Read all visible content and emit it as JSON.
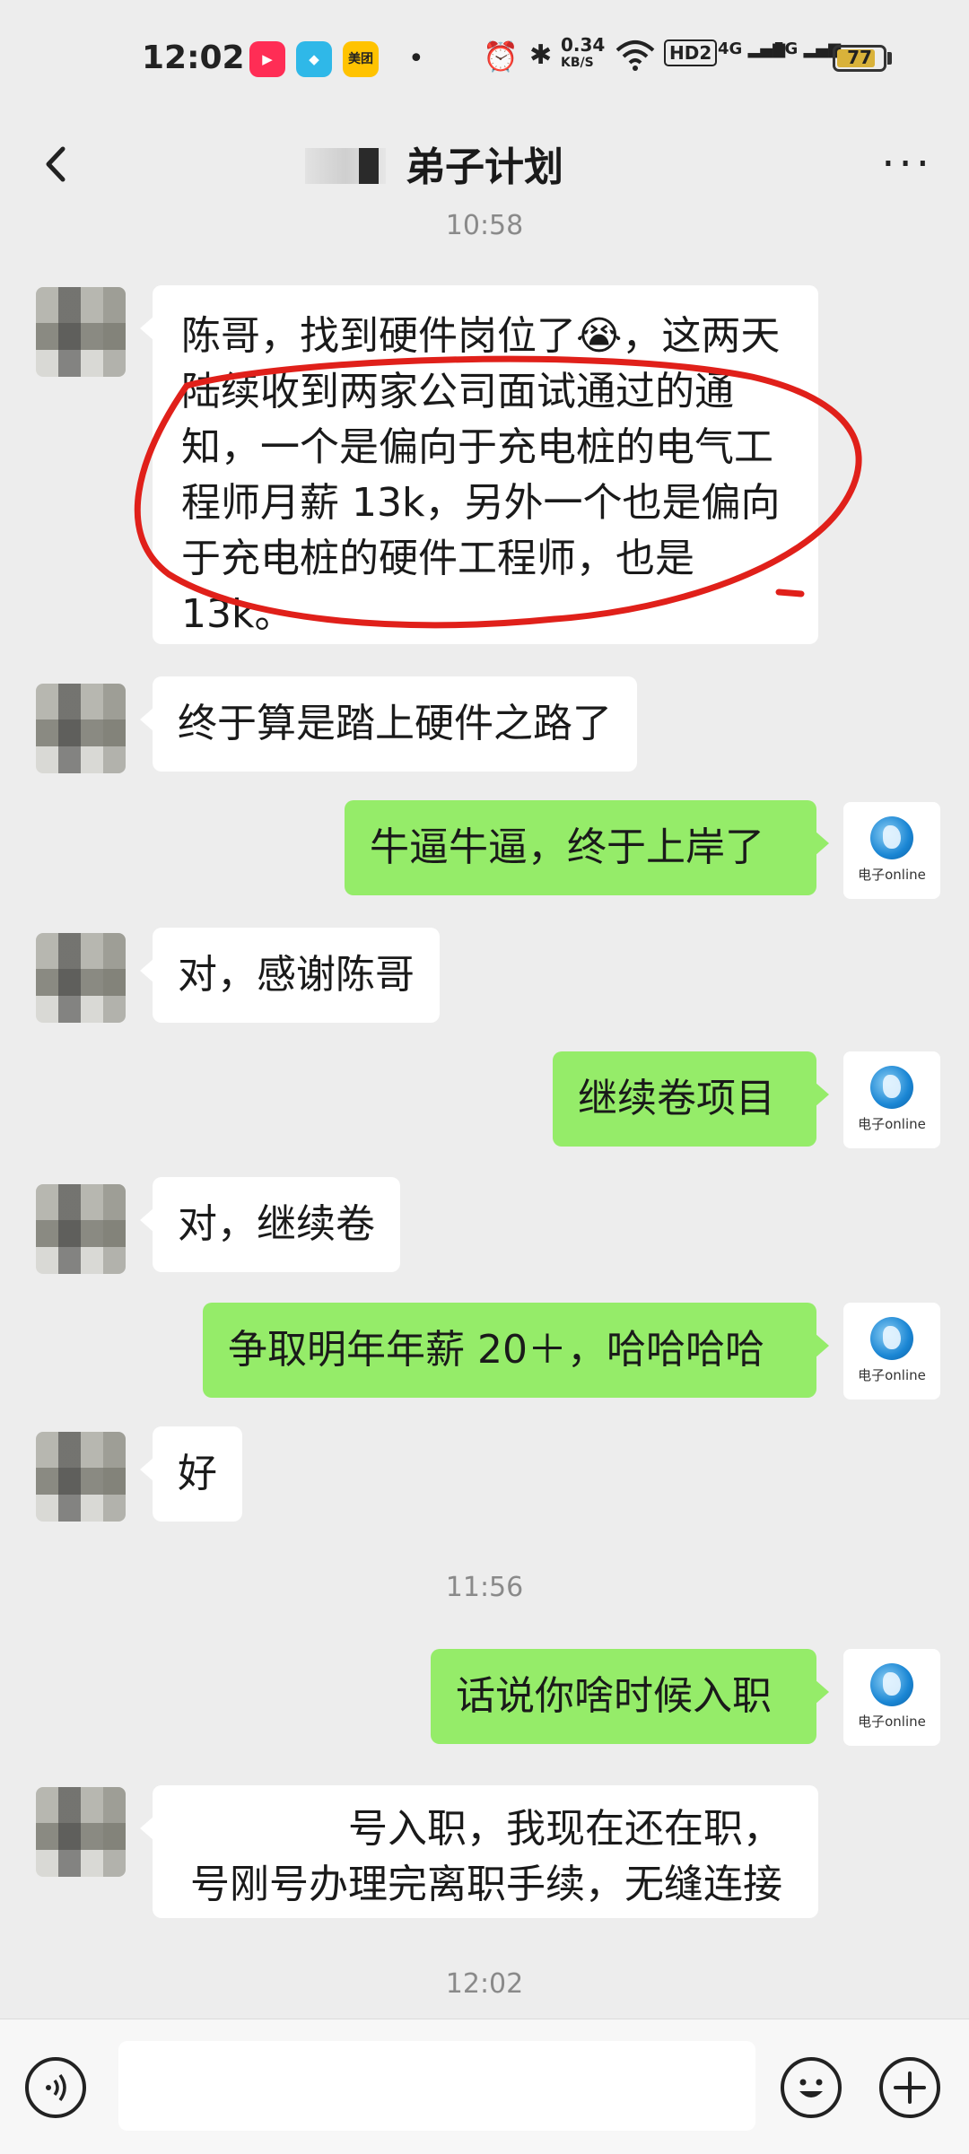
{
  "status_bar": {
    "time": "12:02",
    "app_badge_2": "美团",
    "net_speed": "0.34",
    "net_unit": "KB/S",
    "hd": "HD2",
    "signal_1": "4G",
    "signal_2": "5G",
    "battery": "77"
  },
  "nav": {
    "title": "弟子计划"
  },
  "timestamps": [
    "10:58",
    "11:56",
    "12:02"
  ],
  "messages": [
    {
      "side": "left",
      "lines": [
        "陈哥，找到硬件岗位了😭，这两天",
        "陆续收到两家公司面试通过的通",
        "知，一个是偏向于充电桩的电气工",
        "程师月薪 13k，另外一个也是偏向",
        "于充电桩的硬件工程师，也是",
        "13k。"
      ]
    },
    {
      "side": "left",
      "text": "终于算是踏上硬件之路了"
    },
    {
      "side": "right",
      "text": "牛逼牛逼，终于上岸了"
    },
    {
      "side": "left",
      "text": "对，感谢陈哥"
    },
    {
      "side": "right",
      "text": "继续卷项目"
    },
    {
      "side": "left",
      "text": "对，继续卷"
    },
    {
      "side": "right",
      "text": "争取明年年薪 20＋，哈哈哈哈"
    },
    {
      "side": "left",
      "text": "好"
    },
    {
      "side": "right",
      "text": "话说你啥时候入职"
    },
    {
      "side": "left",
      "lines": [
        "号入职，我现在还在职，",
        "号刚号办理完离职手续，无缝连接"
      ]
    }
  ],
  "self_avatar_label": "电子online",
  "colors": {
    "self_bubble": "#95ec69",
    "other_bubble": "#ffffff",
    "background": "#ededed",
    "annotation": "#e0201a"
  }
}
